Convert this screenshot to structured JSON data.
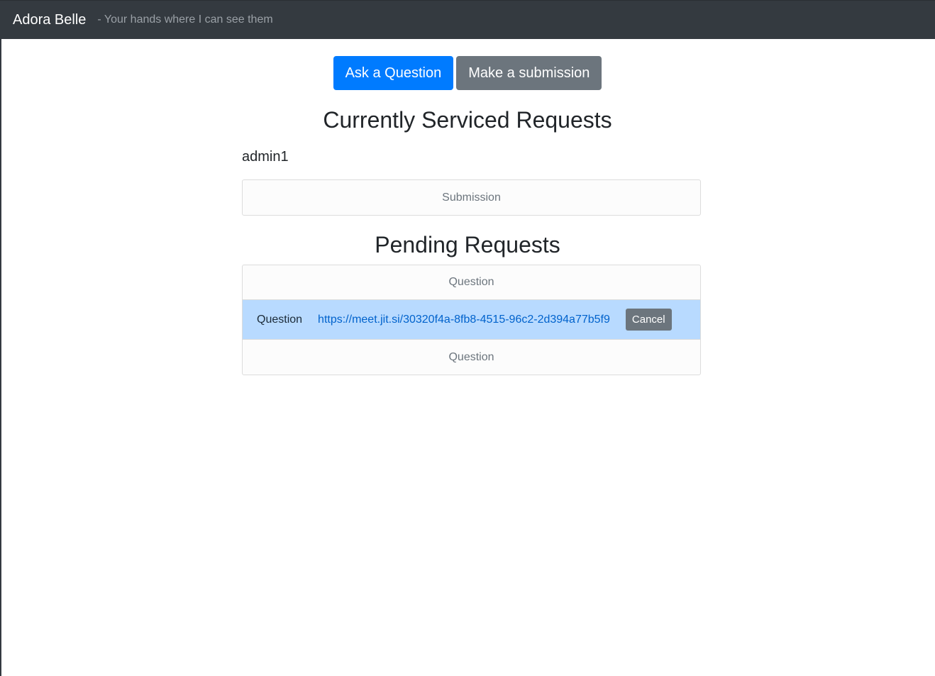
{
  "navbar": {
    "brand": "Adora Belle",
    "tagline": "- Your hands where I can see them"
  },
  "actions": {
    "ask_label": "Ask a Question",
    "submit_label": "Make a submission"
  },
  "serviced": {
    "heading": "Currently Serviced Requests",
    "admin": "admin1",
    "items": [
      {
        "type": "Submission"
      }
    ]
  },
  "pending": {
    "heading": "Pending Requests",
    "items": [
      {
        "type": "Question"
      },
      {
        "type": "Question",
        "link": "https://meet.jit.si/30320f4a-8fb8-4515-96c2-2d394a77b5f9",
        "cancel_label": "Cancel"
      },
      {
        "type": "Question"
      }
    ]
  },
  "colors": {
    "navbar": "#343a40",
    "primary": "#007bff",
    "secondary": "#6c757d",
    "active_row": "#b8daff",
    "link": "#0062cc"
  }
}
